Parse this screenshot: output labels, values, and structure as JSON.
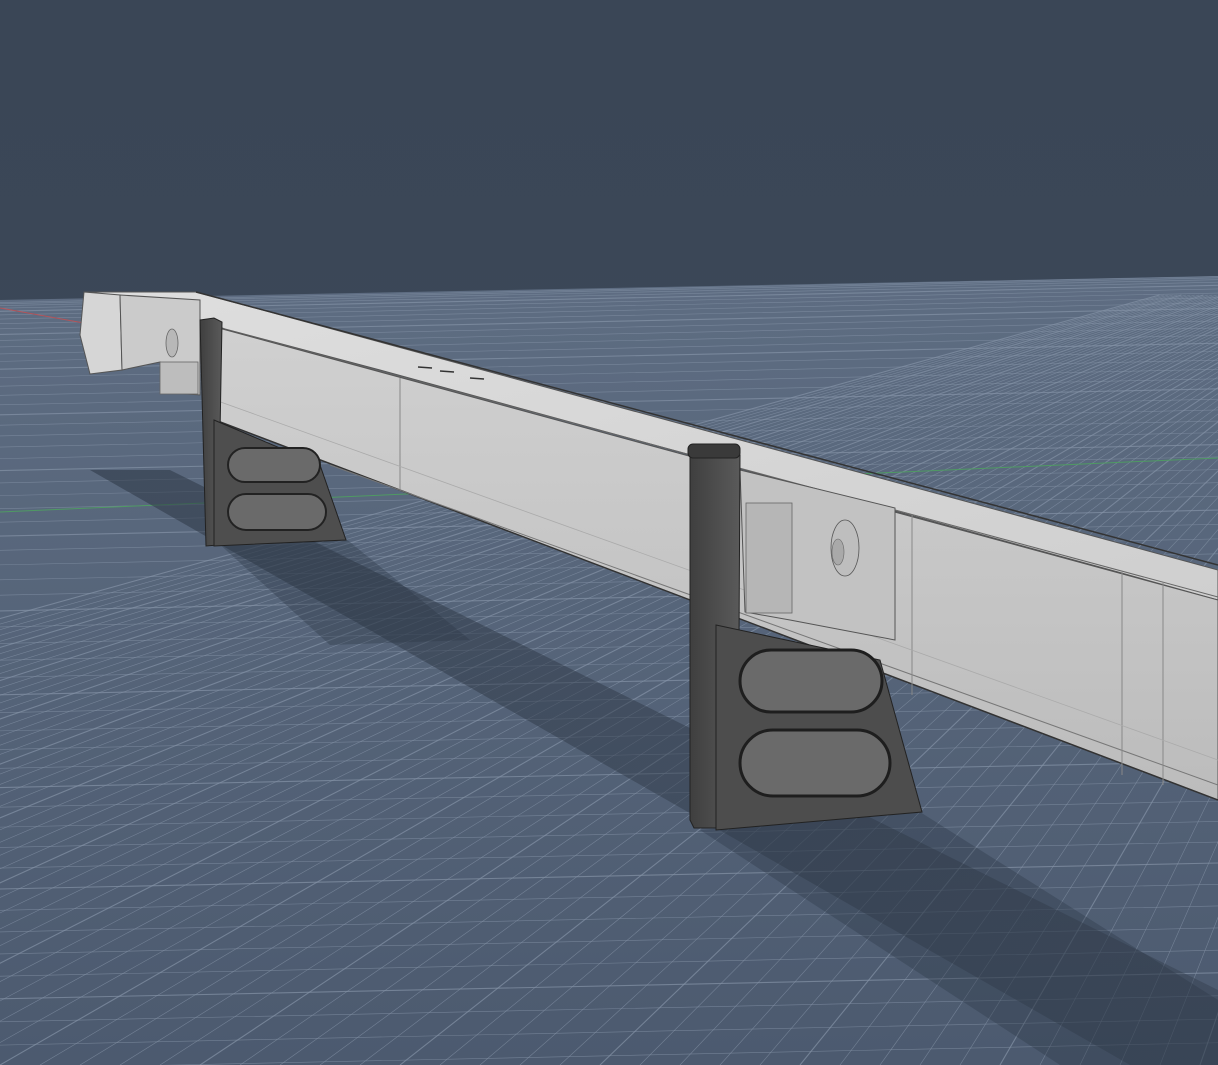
{
  "viewport": {
    "background_color": "#3a4656",
    "ground_color": "#4f5e73",
    "grid_line_color": "#8593a6",
    "x_axis_color": "#b2545a",
    "y_axis_color": "#4f9a63"
  },
  "model": {
    "body_color": "#c9c9c9",
    "edge_color": "#444444",
    "bracket_color": "#4d4d4d",
    "bracket_count": 2,
    "bracket_slot_count": 2
  }
}
